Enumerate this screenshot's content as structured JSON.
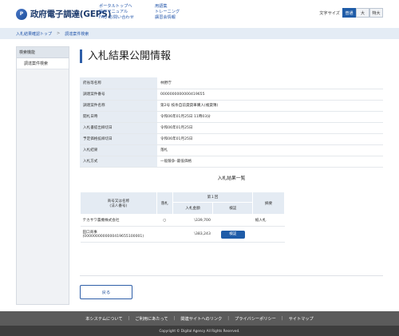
{
  "header": {
    "logo_mark": "P",
    "logo_text": "政府電子調達(GEPS)",
    "nav_col1": [
      "ポータルトップへ",
      "操作マニュアル",
      "FAQ･お問い合わせ"
    ],
    "nav_col2": [
      "用語集",
      "トレーニング",
      "講習会情報"
    ],
    "font_size_label": "文字サイズ",
    "font_sizes": [
      "普通",
      "大",
      "特大"
    ],
    "font_size_selected": "普通"
  },
  "breadcrumb": [
    "入札結果確認トップ",
    "調達案件検索"
  ],
  "sidebar": {
    "heading": "検索機能",
    "items": [
      "調達案件検索"
    ]
  },
  "page_title": "入札結果公開情報",
  "info_rows": [
    {
      "label": "府省等名称",
      "value": "林野庁"
    },
    {
      "label": "調達案件番号",
      "value": "0000000000000419655"
    },
    {
      "label": "調達案件名称",
      "value": "第2号 枝条自前貸貸車購入(複貸簿)"
    },
    {
      "label": "開札日時",
      "value": "令和06年01月25日 11時03分"
    },
    {
      "label": "入札書提出締切日",
      "value": "令和06年01月25日"
    },
    {
      "label": "予定価格拡締切日",
      "value": "令和06年01月25日"
    },
    {
      "label": "入札結果",
      "value": "落札"
    },
    {
      "label": "入札方式",
      "value": "一般競争･最低価格"
    }
  ],
  "results": {
    "title": "入札結果一覧",
    "headers": {
      "company": "商号又は名称\n(法人番号)",
      "award": "落札",
      "round": "第１回",
      "amount": "入札金額",
      "verify": "検証",
      "remarks": "摘要"
    },
    "rows": [
      {
        "company": "テカサワ農機株式会社",
        "company_sub": "",
        "award": "○",
        "amount": "\\339,700",
        "verify_button": "",
        "remarks": "紙入札"
      },
      {
        "company": "田口商事",
        "company_sub": "(0000000000000419655100001)",
        "award": "",
        "amount": "\\383,243",
        "verify_button": "検証",
        "remarks": ""
      }
    ]
  },
  "back_button": "戻る",
  "footer": {
    "links": [
      "本システムについて",
      "ご利用にあたって",
      "関連サイトへのリンク",
      "プライバシーポリシー",
      "サイトマップ"
    ],
    "copyright": "Copyright © Digital Agency All Rights Reserved."
  },
  "colors": {
    "accent": "#1f5ca8",
    "breadcrumb_bg": "#e4ecf5",
    "footer_bg": "#5b5b5b"
  }
}
